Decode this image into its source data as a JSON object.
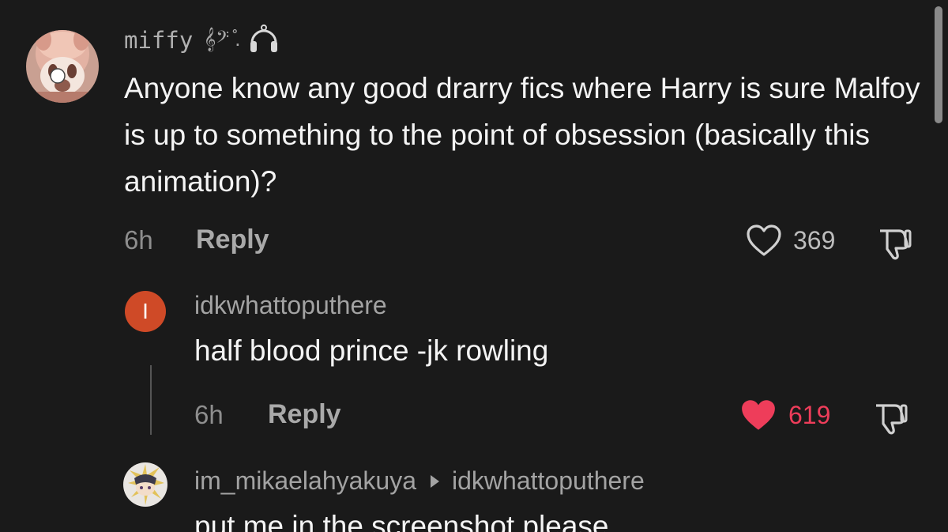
{
  "comments": {
    "main": {
      "username": "miffy",
      "username_decoration": "𝄞𝄢 ̊.",
      "badge_icon": "headphones-icon",
      "text": "Anyone know any good drarry fics where Harry is sure Malfoy is up to something to the point of obsession (basically this animation)?",
      "time": "6h",
      "reply_label": "Reply",
      "likes": "369",
      "liked": false
    },
    "reply1": {
      "avatar_letter": "I",
      "avatar_color": "#cf4a27",
      "username": "idkwhattoputhere",
      "text": "half blood prince -jk rowling",
      "time": "6h",
      "reply_label": "Reply",
      "likes": "619",
      "liked": true,
      "liked_color": "#ee3d5a"
    },
    "reply2": {
      "username": "im_mikaelahyakuya",
      "reply_to": "idkwhattoputhere",
      "text": "put me in the screenshot please"
    }
  },
  "colors": {
    "background": "#1a1a1a",
    "text_primary": "#f4f4f4",
    "text_secondary": "#a3a3a3"
  }
}
